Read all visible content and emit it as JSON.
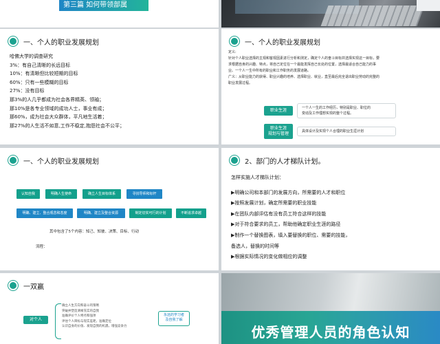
{
  "slide1": {
    "tag": "第三篇 如何带领部属"
  },
  "slide3": {
    "heading": "一、个人的职业发展规划",
    "lines": [
      "哈佛大学的调查研究",
      "3%：有自己清晰的长远目标",
      "10%：有清晰但比较短期的目标",
      "60%：只有一些模糊的目标",
      "27%：没有目标",
      "那3%的人几乎都成为社会各界精英、领袖；",
      "那10%是各专业领域的成功人士，事业有成；",
      "那60%，成为社会大众群体，平凡地生活着；",
      "那27%的人生活不如意,工作不稳定,抱怨社会不公平；"
    ]
  },
  "slide4": {
    "heading": "一、个人的职业发展规划",
    "lines": [
      "定义:",
      "针对个人职业选择的主观和客观因素进行分析和测定，确定个人的奋斗目标并选择实现这一目标，要",
      "求根据自身的兴趣、特点，将自己定位在一个最能发挥自己长处的位置，选择最适合自己能力的事",
      "业。一个人一生中所有的职业和工作职务的发展道路。",
      "广义：从职业能力的获得、职业兴趣的培养、选择职业、就业，直至最后完全退出职业劳动的完整的",
      "职业发展过程。"
    ],
    "defs": [
      {
        "key": "职业生涯",
        "val": [
          "一个人一生的工作经历，特别是职业、职位的",
          "变动及工作理想实现的整个过程。"
        ]
      },
      {
        "key": [
          "职业生涯",
          "规划与管理"
        ],
        "val": [
          "具体设计及实现个人合理的职业生涯计划"
        ]
      }
    ]
  },
  "slide5": {
    "heading": "一、个人的职业发展规划",
    "row1": [
      "认知自我",
      "明确人生使命",
      "确立人生目标体系",
      "寻找导师和标杆"
    ],
    "row2": [
      "明确、建立、整合观念和态度",
      "明确、建立及整合资源",
      "制定切实可行的计划",
      "不断追求卓越"
    ],
    "note": "其中包含了5个内容：知己、知彼、决策、目标、行动",
    "flow_label": "流程："
  },
  "slide6": {
    "heading": "2、部门的人才梯队计划。",
    "lines": [
      "怎样实施人才梯队计划：",
      "",
      "▶明确公司和本部门的发展方向，所需要的人才和职位",
      "▶按照发展计划，确定所需要的职业技能",
      "▶在团队内部评估有没有员工符合这样的技能",
      "▶对于符合要求的员工，帮助他确定职业生涯的路径",
      "▶制作一个替换图表，填入要替换的职位、需要的技能，",
      "   备选人，替换的时间等",
      "▶根据实际情况的变化做相应的调整"
    ]
  },
  "slide7": {
    "heading": "一双赢",
    "pill": "对个人",
    "list": [
      "确立人生方向和奋斗的策略",
      "突破并塑造清晰充实的自我",
      "准确评价个人特点和强项",
      "评估个人目标与现实差距，准确定位",
      "认识自身的价值、发现自我的机遇，增强竞争力"
    ],
    "callout": [
      "永远的学习者",
      "及自我了解"
    ]
  },
  "slide8": {
    "title": "优秀管理人员的角色认知"
  },
  "colors": {
    "teal": "#1ba28f",
    "blue": "#1f86c6"
  }
}
